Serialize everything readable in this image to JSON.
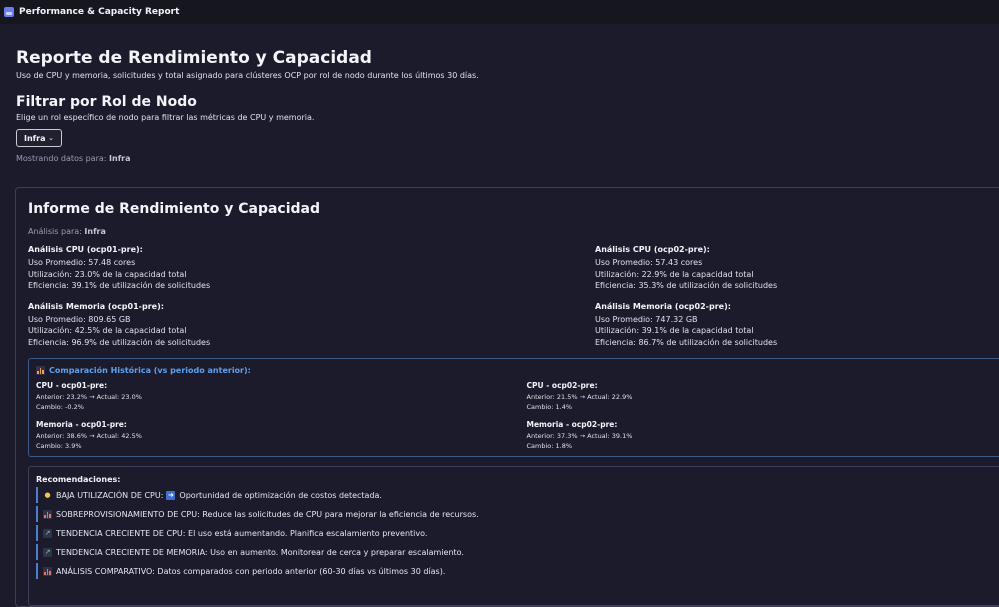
{
  "app": {
    "title": "Performance & Capacity Report"
  },
  "header": {
    "title": "Reporte de Rendimiento y Capacidad",
    "subtitle": "Uso de CPU y memoria, solicitudes y total asignado para clústeres OCP por rol de nodo durante los últimos 30 días."
  },
  "filter": {
    "title": "Filtrar por Rol de Nodo",
    "description": "Elige un rol específico de nodo para filtrar las métricas de CPU y memoria.",
    "selected": "Infra",
    "showing_label": "Mostrando datos para:",
    "showing_value": "Infra"
  },
  "report": {
    "title": "Informe de Rendimiento y Capacidad",
    "analysis_label": "Análisis para:",
    "analysis_value": "Infra",
    "left": {
      "cpu": {
        "title": "Análisis CPU (ocp01-pre):",
        "lines": [
          "Uso Promedio: 57.48 cores",
          "Utilización: 23.0% de la capacidad total",
          "Eficiencia: 39.1% de utilización de solicitudes"
        ]
      },
      "mem": {
        "title": "Análisis Memoria (ocp01-pre):",
        "lines": [
          "Uso Promedio: 809.65 GB",
          "Utilización: 42.5% de la capacidad total",
          "Eficiencia: 96.9% de utilización de solicitudes"
        ]
      }
    },
    "right": {
      "cpu": {
        "title": "Análisis CPU (ocp02-pre):",
        "lines": [
          "Uso Promedio: 57.43 cores",
          "Utilización: 22.9% de la capacidad total",
          "Eficiencia: 35.3% de utilización de solicitudes"
        ]
      },
      "mem": {
        "title": "Análisis Memoria (ocp02-pre):",
        "lines": [
          "Uso Promedio: 747.32 GB",
          "Utilización: 39.1% de la capacidad total",
          "Eficiencia: 86.7% de utilización de solicitudes"
        ]
      }
    },
    "history": {
      "title": "Comparación Histórica (vs periodo anterior):",
      "left": [
        {
          "name": "CPU - ocp01-pre:",
          "line1": "Anterior: 23.2% → Actual: 23.0%",
          "line2": "Cambio: -0.2%"
        },
        {
          "name": "Memoria - ocp01-pre:",
          "line1": "Anterior: 38.6% → Actual: 42.5%",
          "line2": "Cambio: 3.9%"
        }
      ],
      "right": [
        {
          "name": "CPU - ocp02-pre:",
          "line1": "Anterior: 21.5% → Actual: 22.9%",
          "line2": "Cambio: 1.4%"
        },
        {
          "name": "Memoria - ocp02-pre:",
          "line1": "Anterior: 37.3% → Actual: 39.1%",
          "line2": "Cambio: 1.8%"
        }
      ]
    },
    "recommendations": {
      "title": "Recomendaciones:",
      "items": [
        {
          "before": "BAJA UTILIZACIÓN DE CPU:",
          "after": "Oportunidad de optimización de costos detectada."
        },
        {
          "text": "SOBREPROVISIONAMIENTO DE CPU: Reduce las solicitudes de CPU para mejorar la eficiencia de recursos."
        },
        {
          "text": "TENDENCIA CRECIENTE DE CPU: El uso está aumentando. Planifica escalamiento preventivo."
        },
        {
          "text": "TENDENCIA CRECIENTE DE MEMORIA: Uso en aumento. Monitorear de cerca y preparar escalamiento."
        },
        {
          "text": "ANÁLISIS COMPARATIVO: Datos comparados con periodo anterior (60-30 días vs últimos 30 días)."
        }
      ]
    }
  },
  "icons": {
    "app": "app-icon",
    "dropdown": "chevron-down-icon",
    "history": "bar-chart-icon",
    "rec": [
      "lightbulb-icon",
      "bar-chart-icon",
      "trending-up-icon",
      "trending-up-icon",
      "bar-chart-icon"
    ],
    "rec_inline": "arrow-right-icon"
  },
  "colors": {
    "background": "#1b1b2b",
    "accent_blue": "#5ba3f0",
    "border": "#3c3f55"
  }
}
